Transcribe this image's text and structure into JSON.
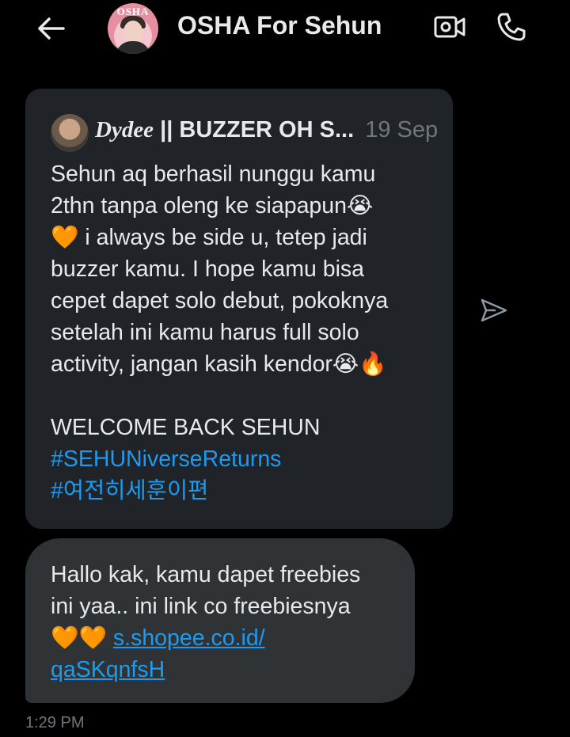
{
  "header": {
    "title": "OSHA For Sehun",
    "avatar_text": "OSHA",
    "back_icon": "arrow-left-icon",
    "video_icon": "video-call-icon",
    "call_icon": "phone-icon"
  },
  "quoted_post": {
    "author_script": "Dydee",
    "author_rest": " || BUZZER OH S...",
    "date": "19 Sep",
    "lines": [
      "Sehun aq berhasil nunggu kamu",
      "2thn tanpa oleng ke siapapun😭",
      "🧡 i always be side u, tetep jadi",
      "buzzer kamu. I hope kamu bisa",
      "cepet dapet solo debut, pokoknya",
      "setelah ini kamu harus full solo",
      "activity, jangan kasih kendor😭🔥",
      "",
      "WELCOME BACK SEHUN"
    ],
    "hashtags": [
      "#SEHUNiverseReturns",
      "#여전히세훈이편"
    ]
  },
  "share_icon": "send-icon",
  "message": {
    "line1": "Hallo kak, kamu dapet freebies",
    "line2": "ini yaa.. ini link co freebiesnya",
    "emoji": "🧡🧡",
    "link_part1": "s.shopee.co.id/",
    "link_part2": "qaSKqnfsH",
    "time": "1:29 PM"
  },
  "colors": {
    "background": "#000000",
    "bubble_quote": "#202327",
    "bubble_message": "#2f3336",
    "link": "#1d9bf0",
    "muted": "#71767b",
    "text": "#e7e9ea"
  }
}
